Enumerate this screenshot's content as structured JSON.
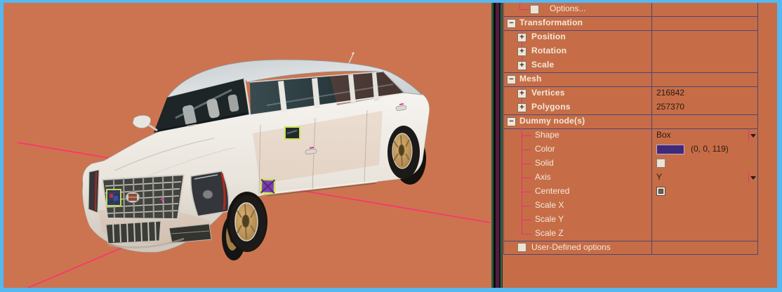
{
  "window": {
    "border_color": "#55b8f0"
  },
  "viewport": {
    "background": "#cc7450",
    "axis_line_color": "#ff2e74",
    "model": "white stretched limousine 3d model",
    "dummy_marker_fill": "#7b3fae",
    "dummy_marker_outline": "#cbe257"
  },
  "panel": {
    "background": "#c66d47",
    "grid_line_color": "#4c4673",
    "tree_line_color": "#e83078",
    "label_color": "#f4e9da",
    "value_color": "#2f1a10",
    "rows": [
      {
        "label": "Options...",
        "type": "checkbox-item",
        "checked": false
      },
      {
        "label": "Transformation",
        "type": "category"
      },
      {
        "label": "Position",
        "type": "expandable"
      },
      {
        "label": "Rotation",
        "type": "expandable"
      },
      {
        "label": "Scale",
        "type": "expandable"
      },
      {
        "label": "Mesh",
        "type": "category"
      },
      {
        "label": "Vertices",
        "type": "expandable",
        "value": "216842"
      },
      {
        "label": "Polygons",
        "type": "expandable",
        "value": "257370"
      },
      {
        "label": "Dummy node(s)",
        "type": "category"
      },
      {
        "label": "Shape",
        "type": "dropdown",
        "value": "Box"
      },
      {
        "label": "Color",
        "type": "color",
        "value": "(0, 0, 119)",
        "swatch": "#3e2a78"
      },
      {
        "label": "Solid",
        "type": "checkbox",
        "checked": false
      },
      {
        "label": "Axis",
        "type": "dropdown",
        "value": "Y"
      },
      {
        "label": "Centered",
        "type": "checkbox",
        "checked": true
      },
      {
        "label": "Scale X",
        "type": "plain"
      },
      {
        "label": "Scale Y",
        "type": "plain"
      },
      {
        "label": "Scale Z",
        "type": "plain"
      },
      {
        "label": "User-Defined options",
        "type": "checkbox-item",
        "checked": false
      }
    ]
  }
}
